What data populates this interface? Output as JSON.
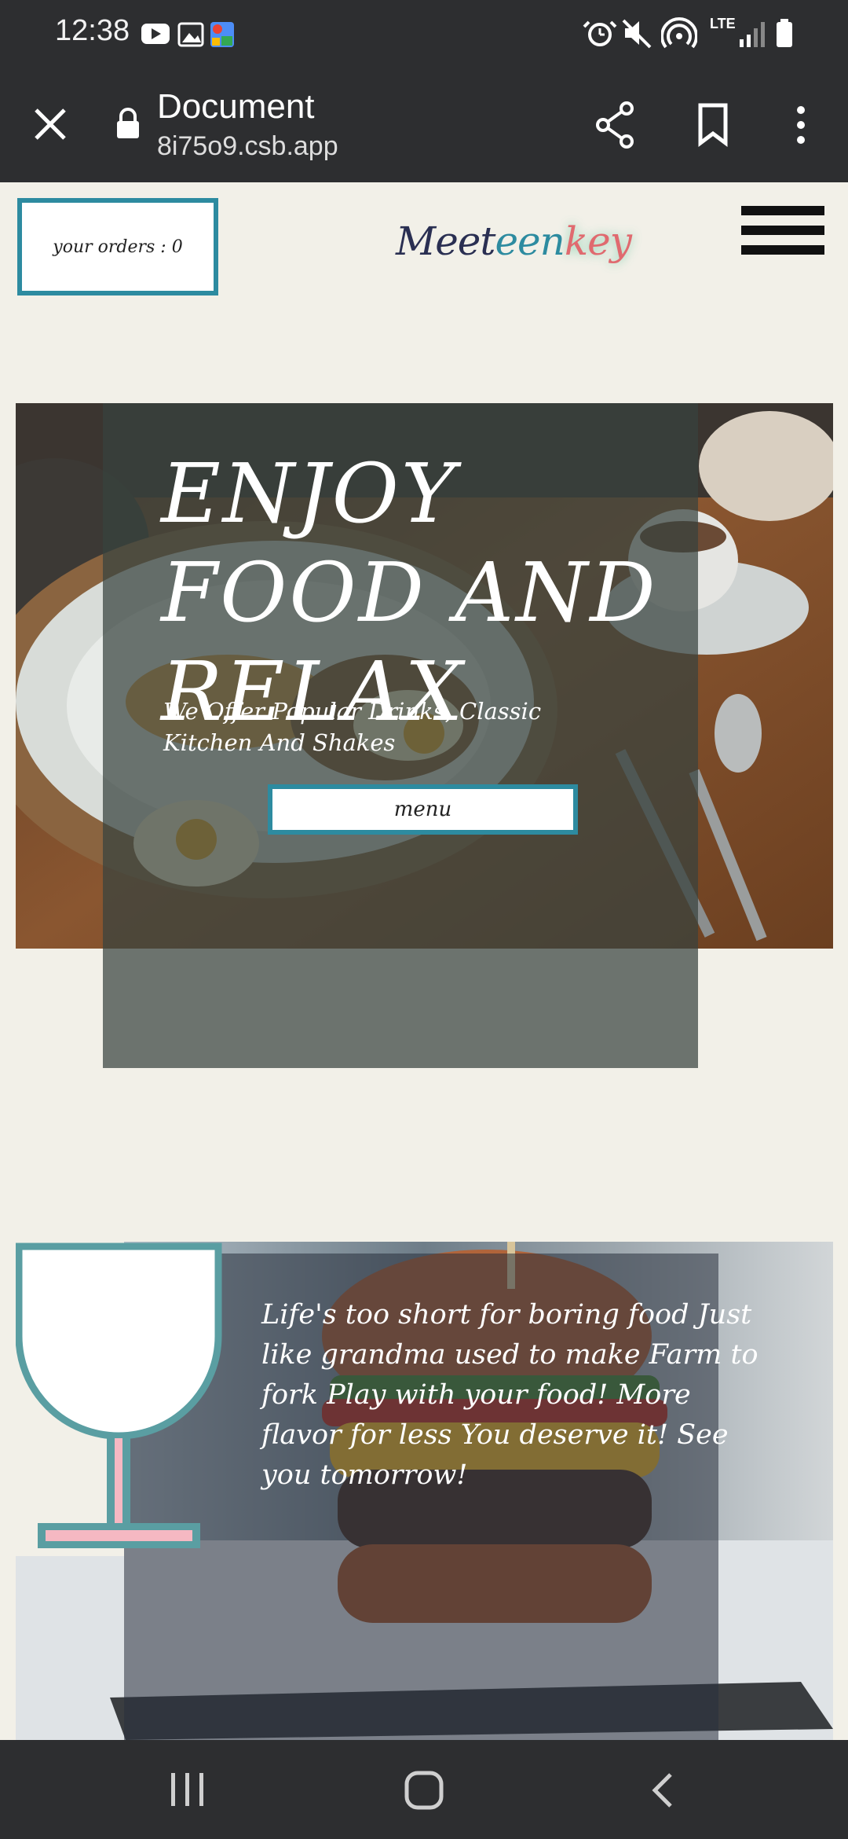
{
  "status": {
    "time": "12:38",
    "network": "LTE"
  },
  "browser": {
    "title": "Document",
    "url": "8i75o9.csb.app"
  },
  "header": {
    "orders_label": "your orders : 0",
    "logo": {
      "part1": "Meet",
      "part2": "een",
      "part3": "key"
    }
  },
  "hero": {
    "title": "ENJOY FOOD AND RELAX",
    "subtitle": "We Offer Popular Drinks, Classic Kitchen And Shakes",
    "menu_button": "menu"
  },
  "section2": {
    "quote": "Life's too short for boring food Just like grandma used to make Farm to fork Play with your food! More flavor for less You deserve it! See you tomorrow!"
  },
  "colors": {
    "accent": "#2d8ba0",
    "glass_outline": "#5a9ea2",
    "glass_stem": "#f5b8c2",
    "bar": "#2d2e30"
  }
}
